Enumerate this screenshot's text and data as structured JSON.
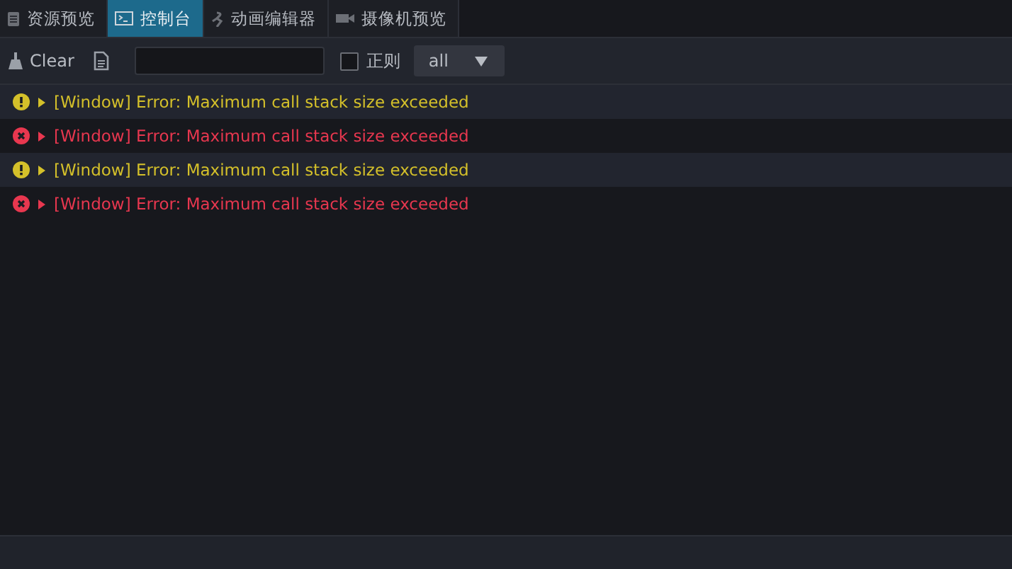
{
  "tabs": [
    {
      "label": "资源预览",
      "kind": "doc",
      "selected": false
    },
    {
      "label": "控制台",
      "kind": "terminal",
      "selected": true
    },
    {
      "label": "动画编辑器",
      "kind": "anim",
      "selected": false
    },
    {
      "label": "摄像机预览",
      "kind": "camera",
      "selected": false
    }
  ],
  "toolbar": {
    "clear_label": "Clear",
    "regex": {
      "label": "正则",
      "checked": false
    },
    "filter": "all"
  },
  "logs": [
    {
      "kind": "warning",
      "text": "[Window] Error: Maximum call stack size exceeded"
    },
    {
      "kind": "error",
      "text": "[Window] Error: Maximum call stack size exceeded"
    },
    {
      "kind": "warning",
      "text": "[Window] Error: Maximum call stack size exceeded"
    },
    {
      "kind": "error",
      "text": "[Window] Error: Maximum call stack size exceeded"
    }
  ]
}
